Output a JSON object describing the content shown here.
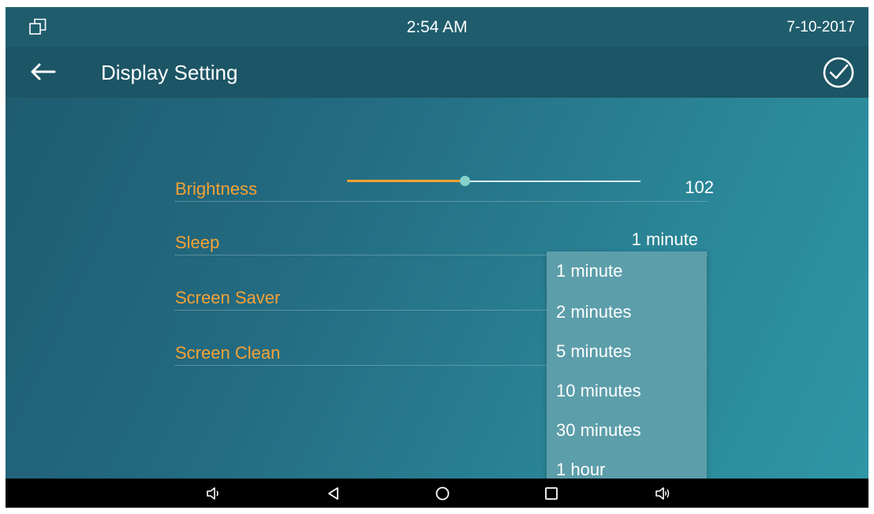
{
  "status_bar": {
    "time": "2:54 AM",
    "date": "7-10-2017",
    "multiwindow_icon": "multiwindow-icon"
  },
  "title_bar": {
    "back_icon": "arrow-left-icon",
    "title": "Display Setting",
    "confirm_icon": "check-circle-icon"
  },
  "settings": {
    "brightness": {
      "label": "Brightness",
      "value": "102",
      "slider_fraction": 0.4
    },
    "sleep": {
      "label": "Sleep",
      "value": "1 minute"
    },
    "screen_saver": {
      "label": "Screen Saver"
    },
    "screen_clean": {
      "label": "Screen Clean"
    }
  },
  "sleep_dropdown": {
    "options": [
      "1 minute",
      "2 minutes",
      "5 minutes",
      "10 minutes",
      "30 minutes",
      "1 hour"
    ]
  },
  "nav_bar": {
    "icons": [
      "volume-down-icon",
      "back-triangle-icon",
      "home-circle-icon",
      "recents-square-icon",
      "volume-up-icon"
    ]
  },
  "colors": {
    "label": "#f5a234",
    "slider_fill": "#f5a234",
    "slider_thumb": "#86d1cb",
    "dropdown_bg": "#5c9eaa"
  }
}
